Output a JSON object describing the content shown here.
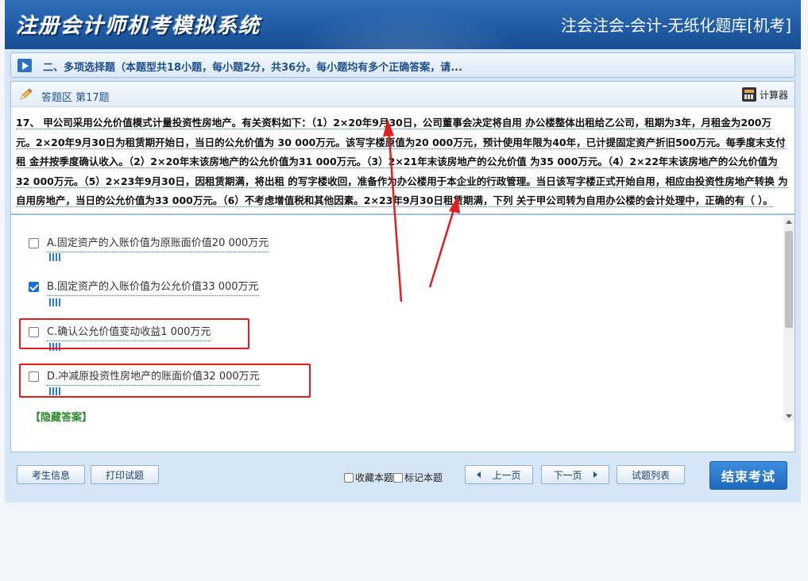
{
  "header": {
    "brand": "注册会计师机考模拟系统",
    "subtitle": "注会注会-会计-无纸化题库[机考]"
  },
  "section": {
    "text": "二、多项选择题（本题型共18小题，每小题2分，共36分。每小题均有多个正确答案，请..."
  },
  "answer_area": {
    "title": "答题区 第17题",
    "calculator_label": "计算器"
  },
  "question": {
    "text": "17、 甲公司采用公允价值模式计量投资性房地产。有关资料如下：（1）2×20年9月30日，公司董事会决定将自用 办公楼整体出租给乙公司，租期为3年，月租金为200万元。2×20年9月30日为租赁期开始日，当日的公允价值为 30 000万元。该写字楼原值为20 000万元，预计使用年限为40年，已计提固定资产折旧500万元。每季度末支付租 金并按季度确认收入。（2）2×20年末该房地产的公允价值为31 000万元。（3）2×21年末该房地产的公允价值 为35 000万元。（4）2×22年末该房地产的公允价值为32 000万元。（5）2×23年9月30日，因租赁期满，将出租 的写字楼收回，准备作为办公楼用于本企业的行政管理。当日该写字楼正式开始自用，相应由投资性房地产转换 为自用房地产，当日的公允价值为33 000万元。（6）不考虑增值税和其他因素。2×23年9月30日租赁期满，下列 关于甲公司转为自用办公楼的会计处理中，正确的有（ ）。"
  },
  "options": [
    {
      "label": "A.固定资产的入账价值为原账面价值20 000万元",
      "checked": false
    },
    {
      "label": "B.固定资产的入账价值为公允价值33 000万元",
      "checked": true
    },
    {
      "label": "C.确认公允价值变动收益1 000万元",
      "checked": false
    },
    {
      "label": "D.冲减原投资性房地产的账面价值32 000万元",
      "checked": false
    }
  ],
  "hide_answer": "【隐藏答案】",
  "footer": {
    "candidate_info": "考生信息",
    "print": "打印试题",
    "favorite": "收藏本题",
    "mark": "标记本题",
    "prev": "上一页",
    "next": "下一页",
    "list": "试题列表",
    "end": "结束考试"
  },
  "colors": {
    "header": "#1f5aa3",
    "accent": "#2b73c2",
    "annotation": "#e02020",
    "hide_answer": "#2f8a2f"
  }
}
